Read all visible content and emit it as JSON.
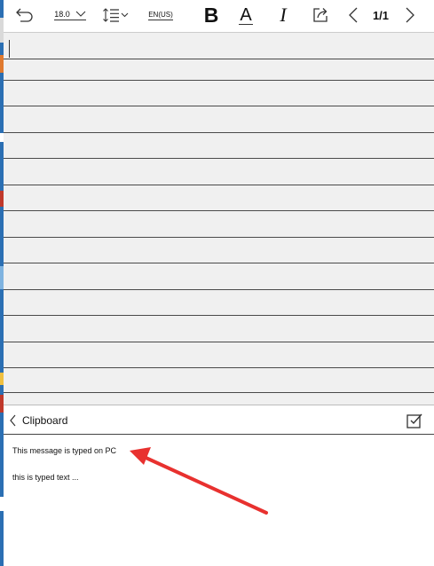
{
  "toolbar": {
    "font_size": "18.0",
    "language": "EN(US)",
    "bold_label": "B",
    "underline_label": "A",
    "italic_label": "I",
    "page_indicator": "1/1"
  },
  "clipboard": {
    "title": "Clipboard",
    "items": [
      "This message is typed on PC",
      "this is typed text ..."
    ]
  },
  "colors": {
    "annotation_arrow": "#e8312f",
    "editor_background": "#f0f0f0",
    "desktop_strip": "#2b6fb3"
  }
}
